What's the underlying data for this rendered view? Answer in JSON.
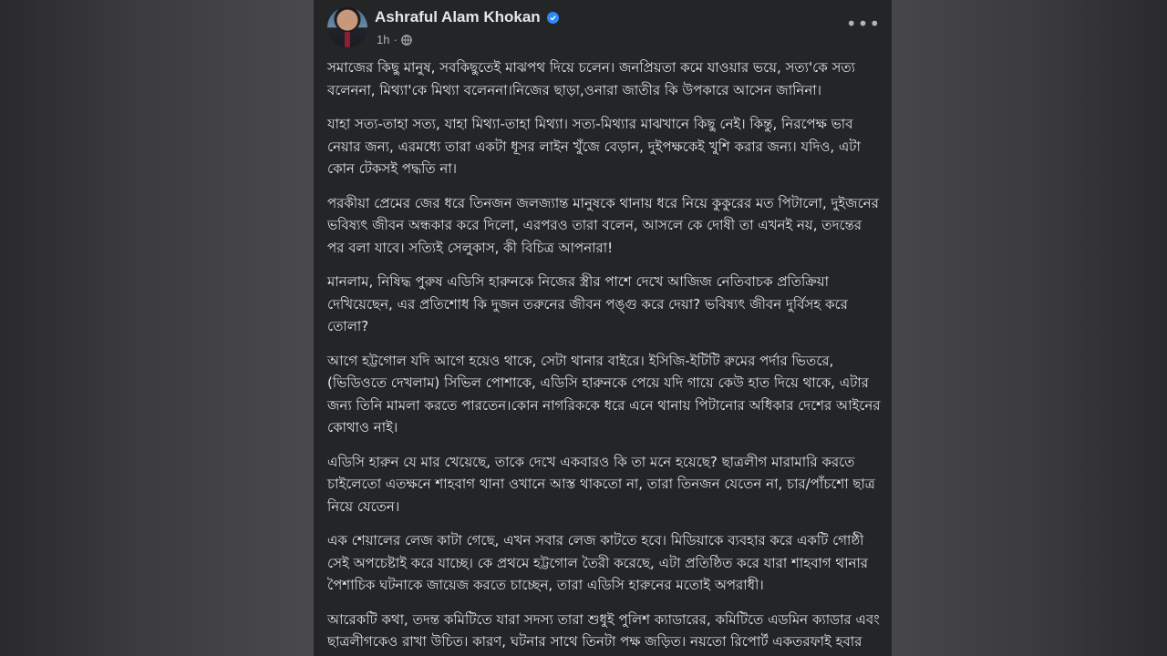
{
  "post": {
    "author": "Ashraful Alam Khokan",
    "verified": true,
    "time": "1h",
    "separator": "·",
    "privacy_icon": "globe-icon",
    "more_icon": "more-options-icon",
    "more_label": "•••",
    "paragraphs": [
      "সমাজের কিছু মানুষ, সবকিছুতেই মাঝপথ দিয়ে চলেন। জনপ্রিয়তা কমে যাওয়ার ভয়ে, সত্য'কে সত্য বলেননা, মিথ্যা'কে মিথ্যা বলেননা।নিজের ছাড়া,ওনারা জাতীর কি উপকারে আসেন জানিনা।",
      "যাহা সত্য-তাহা সত্য, যাহা মিথ্যা-তাহা মিথ্যা। সত্য-মিথ্যার মাঝখানে কিছু নেই। কিন্তু, নিরপেক্ষ ভাব নেয়ার জন্য, এরমধ্যে তারা একটা ধূসর লাইন খুঁজে বেড়ান, দুইপক্ষকেই খুশি করার জন্য। যদিও, এটা কোন টেকসই পদ্ধতি না।",
      "পরকীয়া প্রেমের জের ধরে তিনজন জলজ্যান্ত মানুষকে থানায় ধরে নিয়ে কুকুরের মত পিটালো, দুইজনের ভবিষ্যৎ জীবন অন্ধকার করে দিলো, এরপরও তারা বলেন, আসলে কে দোষী তা এখনই নয়, তদন্তের পর বলা যাবে। সত্যিই সেলুকাস, কী বিচিত্র আপনারা!",
      "মানলাম, নিষিদ্ধ পুরুষ এডিসি হারুনকে নিজের স্ত্রীর পাশে দেখে আজিজ নেতিবাচক প্রতিক্রিয়া দেখিয়েছেন, এর প্রতিশোধ কি দুজন তরুনের জীবন পঙ্গু করে দেয়া? ভবিষ্যৎ জীবন দুর্বিসহ করে তোলা?",
      "আগে হট্টগোল যদি আগে হয়েও থাকে, সেটা থানার বাইরে। ইসিজি-ইটিটি রুমের পর্দার ভিতরে, (ভিডিওতে দেখলাম) সিভিল পোশাকে, এডিসি হারুনকে পেয়ে যদি গায়ে কেউ হাত দিয়ে থাকে, এটার জন্য তিনি মামলা করতে পারতেন।কোন নাগরিককে ধরে এনে থানায় পিটানোর অধিকার দেশের আইনের কোথাও নাই।",
      "এডিসি হারুন যে মার খেয়েছে, তাকে দেখে একবারও কি তা মনে হয়েছে? ছাত্রলীগ মারামারি করতে চাইলেতো এতক্ষনে শাহবাগ থানা ওখানে আস্ত থাকতো না, তারা তিনজন যেতেন না, চার/পাঁচশো ছাত্র নিয়ে যেতেন।",
      "এক শেয়ালের লেজ কাটা গেছে, এখন সবার লেজ কাটতে হবে। মিডিয়াকে ব্যবহার করে একটি গোষ্ঠী সেই অপচেষ্টাই করে যাচ্ছে। কে প্রথমে হট্টগোল তৈরী করেছে, এটা প্রতিষ্ঠিত করে যারা শাহবাগ থানার পৈশাচিক ঘটনাকে জায়েজ করতে চাচ্ছেন, তারা এডিসি হারুনের মতোই অপরাধী।",
      "আরেকটি কথা, তদন্ত কমিটিতে যারা সদস্য তারা শুধুই পুলিশ ক্যাডারের, কমিটিতে এডমিন ক্যাডার এবং ছাত্রলীগকেও রাখা উচিত। কারণ, ঘটনার সাথে তিনটা পক্ষ জড়িত। নয়তো রিপোর্ট একতরফাই হবার সম্ভাবনা বেশি।"
    ]
  }
}
